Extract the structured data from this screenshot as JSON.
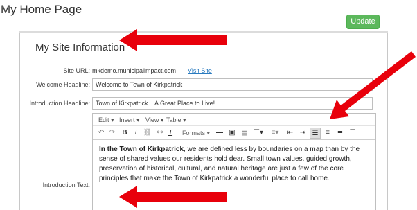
{
  "page": {
    "title": "My Home Page",
    "update_label": "Update"
  },
  "section": {
    "title": "My Site Information"
  },
  "site_url": {
    "label": "Site URL:",
    "value": "mkdemo.municipalimpact.com",
    "link": "Visit Site"
  },
  "welcome": {
    "label": "Welcome Headline:",
    "value": "Welcome to Town of Kirkpatrick"
  },
  "intro_headline": {
    "label": "Introduction Headline:",
    "value": "Town of Kirkpatrick... A Great Place to Live!"
  },
  "intro_text": {
    "label": "Introduction Text:",
    "menu": [
      "Edit",
      "Insert",
      "View",
      "Table"
    ],
    "formats_label": "Formats",
    "bold_lead": "In the Town of Kirkpatrick",
    "body": ", we are defined less by boundaries on a map than by the sense of shared values our residents hold dear. Small town values, guided growth, preservation of historical, cultural, and natural heritage are just a few of the core principles that make the Town of Kirkpatrick a wonderful place to call home."
  },
  "colors": {
    "accent": "#5cb85c",
    "arrow": "#e8000b",
    "link": "#2a7bbf"
  },
  "toolbar_icons": [
    "undo-icon",
    "redo-icon",
    "bold-icon",
    "italic-icon",
    "link-icon",
    "unlink-icon",
    "clear-format-icon",
    "formats-dropdown",
    "horizontal-rule-icon",
    "image-icon",
    "media-icon",
    "bullet-list-icon",
    "numbered-list-icon",
    "outdent-icon",
    "indent-icon",
    "align-left-icon",
    "align-center-icon",
    "align-right-icon",
    "justify-icon"
  ]
}
